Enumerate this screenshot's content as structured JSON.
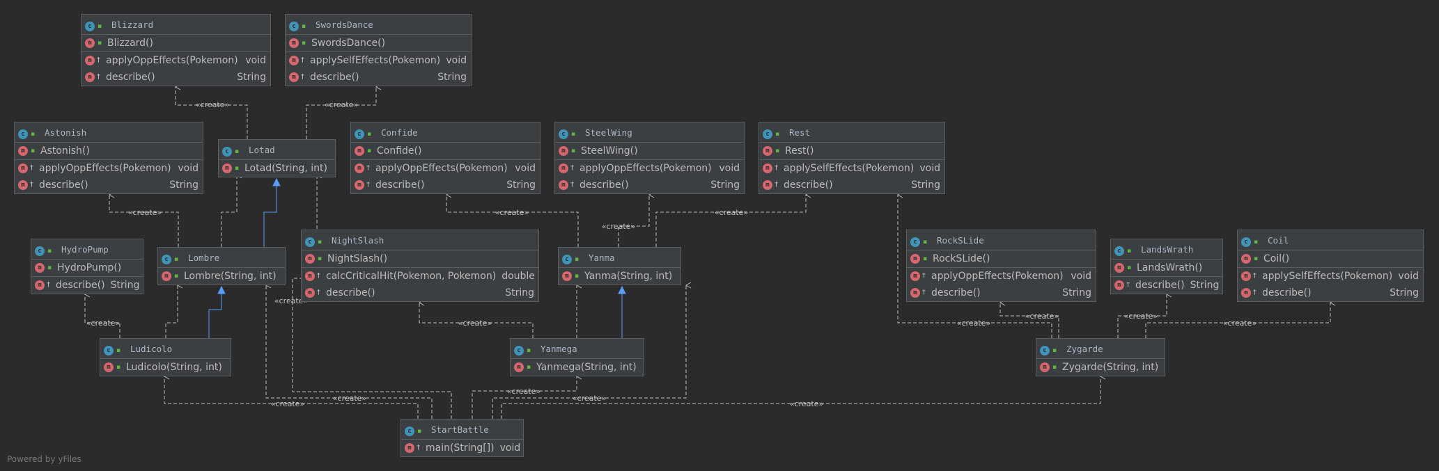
{
  "footer": "Powered by yFiles",
  "edge_label": "«create»",
  "colors": {
    "background": "#2b2b2b",
    "node_fill": "#3c3f41",
    "node_border": "#5b5e60",
    "class_icon": "#3f94b8",
    "method_icon": "#d7676e",
    "inherit_arrow": "#589df6",
    "dependency_line": "#c0c0c0"
  },
  "classes": {
    "blizzard": {
      "name": "Blizzard",
      "members": [
        [
          {
            "sig": "Blizzard()",
            "ret": ""
          }
        ],
        [
          {
            "sig": "applyOppEffects(Pokemon)",
            "ret": "void"
          },
          {
            "sig": "describe()",
            "ret": "String"
          }
        ]
      ]
    },
    "swordsdance": {
      "name": "SwordsDance",
      "members": [
        [
          {
            "sig": "SwordsDance()",
            "ret": ""
          }
        ],
        [
          {
            "sig": "applySelfEffects(Pokemon)",
            "ret": "void"
          },
          {
            "sig": "describe()",
            "ret": "String"
          }
        ]
      ]
    },
    "astonish": {
      "name": "Astonish",
      "members": [
        [
          {
            "sig": "Astonish()",
            "ret": ""
          }
        ],
        [
          {
            "sig": "applyOppEffects(Pokemon)",
            "ret": "void"
          },
          {
            "sig": "describe()",
            "ret": "String"
          }
        ]
      ]
    },
    "lotad": {
      "name": "Lotad",
      "members": [
        [
          {
            "sig": "Lotad(String, int)",
            "ret": ""
          }
        ]
      ]
    },
    "confide": {
      "name": "Confide",
      "members": [
        [
          {
            "sig": "Confide()",
            "ret": ""
          }
        ],
        [
          {
            "sig": "applyOppEffects(Pokemon)",
            "ret": "void"
          },
          {
            "sig": "describe()",
            "ret": "String"
          }
        ]
      ]
    },
    "steelwing": {
      "name": "SteelWing",
      "members": [
        [
          {
            "sig": "SteelWing()",
            "ret": ""
          }
        ],
        [
          {
            "sig": "applyOppEffects(Pokemon)",
            "ret": "void"
          },
          {
            "sig": "describe()",
            "ret": "String"
          }
        ]
      ]
    },
    "rest": {
      "name": "Rest",
      "members": [
        [
          {
            "sig": "Rest()",
            "ret": ""
          }
        ],
        [
          {
            "sig": "applySelfEffects(Pokemon)",
            "ret": "void"
          },
          {
            "sig": "describe()",
            "ret": "String"
          }
        ]
      ]
    },
    "hydropump": {
      "name": "HydroPump",
      "members": [
        [
          {
            "sig": "HydroPump()",
            "ret": ""
          }
        ],
        [
          {
            "sig": "describe()",
            "ret": "String"
          }
        ]
      ]
    },
    "lombre": {
      "name": "Lombre",
      "members": [
        [
          {
            "sig": "Lombre(String, int)",
            "ret": ""
          }
        ]
      ]
    },
    "nightslash": {
      "name": "NightSlash",
      "members": [
        [
          {
            "sig": "NightSlash()",
            "ret": ""
          }
        ],
        [
          {
            "sig": "calcCriticalHit(Pokemon, Pokemon)",
            "ret": "double"
          },
          {
            "sig": "describe()",
            "ret": "String"
          }
        ]
      ]
    },
    "yanma": {
      "name": "Yanma",
      "members": [
        [
          {
            "sig": "Yanma(String, int)",
            "ret": ""
          }
        ]
      ]
    },
    "rockslide": {
      "name": "RockSLide",
      "members": [
        [
          {
            "sig": "RockSLide()",
            "ret": ""
          }
        ],
        [
          {
            "sig": "applyOppEffects(Pokemon)",
            "ret": "void"
          },
          {
            "sig": "describe()",
            "ret": "String"
          }
        ]
      ]
    },
    "landswrath": {
      "name": "LandsWrath",
      "members": [
        [
          {
            "sig": "LandsWrath()",
            "ret": ""
          }
        ],
        [
          {
            "sig": "describe()",
            "ret": "String"
          }
        ]
      ]
    },
    "coil": {
      "name": "Coil",
      "members": [
        [
          {
            "sig": "Coil()",
            "ret": ""
          }
        ],
        [
          {
            "sig": "applySelfEffects(Pokemon)",
            "ret": "void"
          },
          {
            "sig": "describe()",
            "ret": "String"
          }
        ]
      ]
    },
    "ludicolo": {
      "name": "Ludicolo",
      "members": [
        [
          {
            "sig": "Ludicolo(String, int)",
            "ret": ""
          }
        ]
      ]
    },
    "yanmega": {
      "name": "Yanmega",
      "members": [
        [
          {
            "sig": "Yanmega(String, int)",
            "ret": ""
          }
        ]
      ]
    },
    "zygarde": {
      "name": "Zygarde",
      "members": [
        [
          {
            "sig": "Zygarde(String, int)",
            "ret": ""
          }
        ]
      ]
    },
    "startbattle": {
      "name": "StartBattle",
      "members": [
        [
          {
            "sig": "main(String[])",
            "ret": "void"
          }
        ]
      ]
    }
  }
}
